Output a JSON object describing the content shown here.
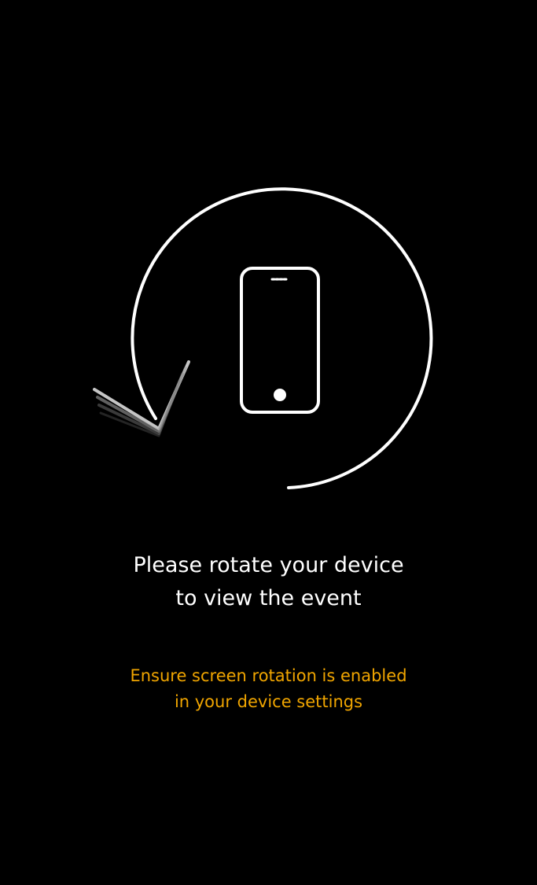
{
  "message": {
    "line1": "Please rotate your device",
    "line2": "to view the event"
  },
  "hint": {
    "line1": "Ensure screen rotation is enabled",
    "line2": "in your device settings"
  },
  "icons": {
    "rotate_arrow": "rotate-arrow-icon",
    "phone": "phone-icon"
  },
  "colors": {
    "background": "#000000",
    "primary_text": "#ffffff",
    "hint_text": "#f0a500"
  }
}
